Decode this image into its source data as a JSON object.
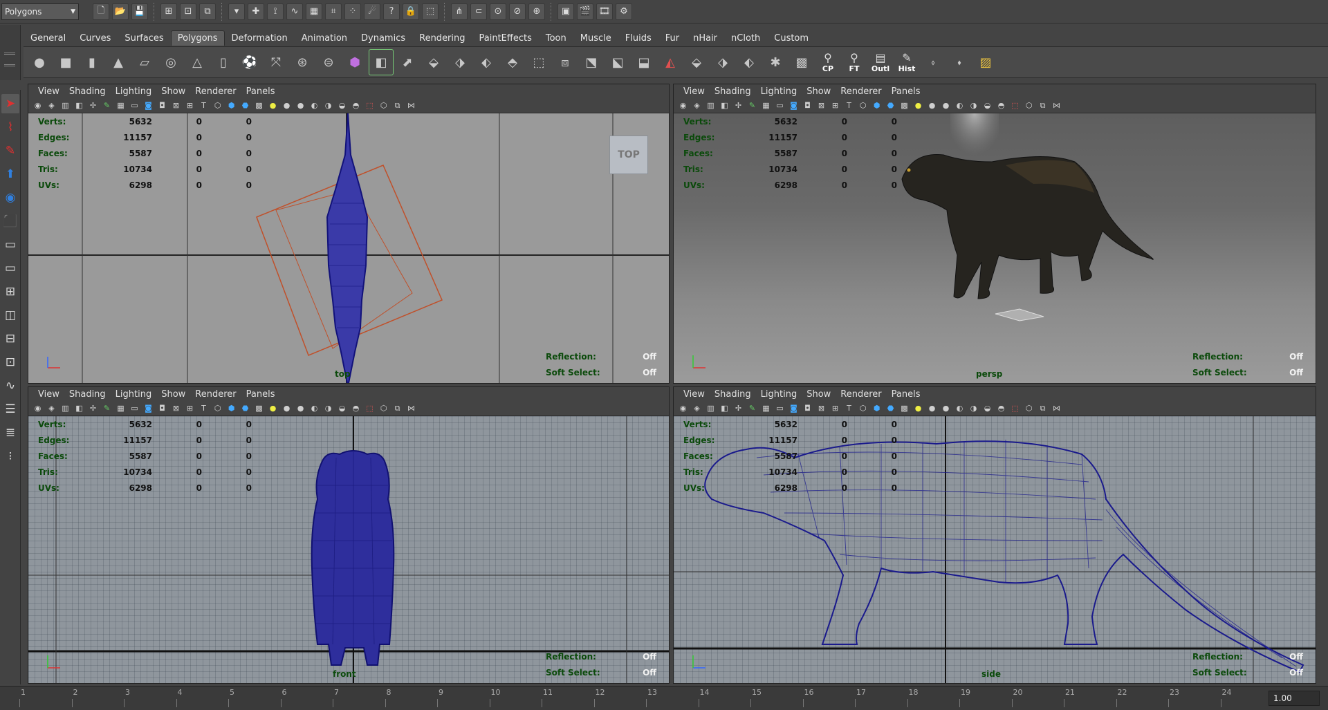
{
  "status_line": {
    "mode": "Polygons"
  },
  "shelf": {
    "tabs": [
      "General",
      "Curves",
      "Surfaces",
      "Polygons",
      "Deformation",
      "Animation",
      "Dynamics",
      "Rendering",
      "PaintEffects",
      "Toon",
      "Muscle",
      "Fluids",
      "Fur",
      "nHair",
      "nCloth",
      "Custom"
    ],
    "active_tab": "Polygons",
    "text_buttons": {
      "cp": "CP",
      "ft": "FT",
      "outl": "Outl",
      "hist": "Hist"
    }
  },
  "panel_menu": [
    "View",
    "Shading",
    "Lighting",
    "Show",
    "Renderer",
    "Panels"
  ],
  "hud": {
    "labels": [
      "Verts:",
      "Edges:",
      "Faces:",
      "Tris:",
      "UVs:"
    ],
    "values": [
      "5632",
      "11157",
      "5587",
      "10734",
      "6298"
    ],
    "zeros": "0",
    "reflection_label": "Reflection:",
    "reflection_value": "Off",
    "soft_select_label": "Soft Select:",
    "soft_select_value": "Off"
  },
  "viewports": {
    "top": {
      "cube_label": "TOP",
      "camera": "top"
    },
    "persp": {
      "camera": "persp"
    },
    "front": {
      "camera": "front"
    },
    "side": {
      "camera": "side"
    }
  },
  "time_slider": {
    "ticks": [
      "1",
      "2",
      "3",
      "4",
      "5",
      "6",
      "7",
      "8",
      "9",
      "10",
      "11",
      "12",
      "13",
      "14",
      "15",
      "16",
      "17",
      "18",
      "19",
      "20",
      "21",
      "22",
      "23",
      "24"
    ],
    "current": "1.00"
  },
  "colors": {
    "wire": "#1a1a8c",
    "hud_green": "#0b4a0b",
    "bbox": "#c0502a"
  }
}
